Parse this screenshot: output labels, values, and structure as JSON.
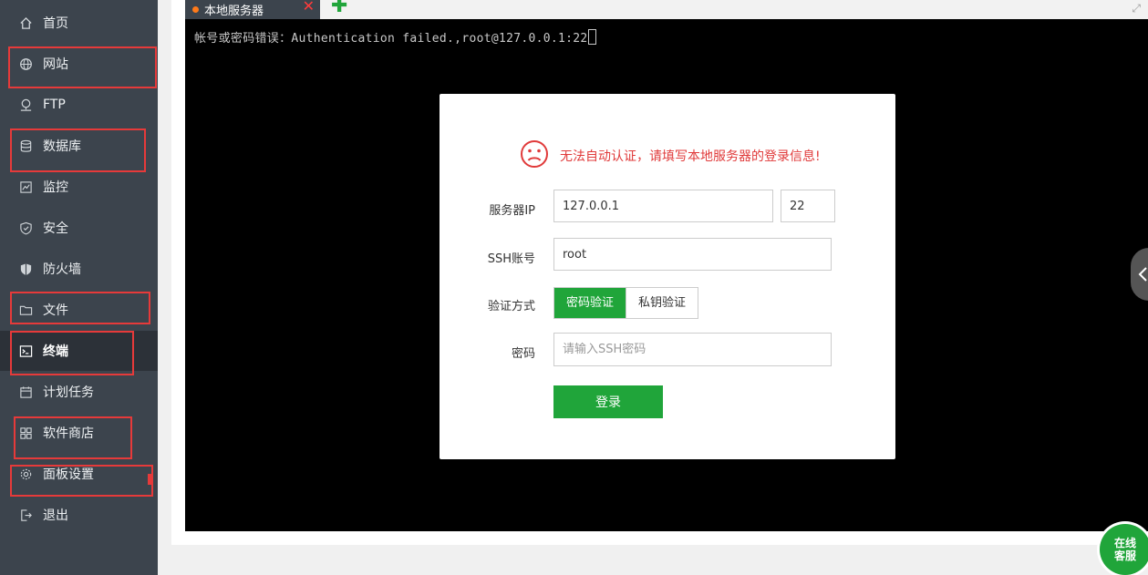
{
  "sidebar": {
    "items": [
      {
        "label": "首页",
        "icon": "home-icon"
      },
      {
        "label": "网站",
        "icon": "globe-icon"
      },
      {
        "label": "FTP",
        "icon": "ftp-icon"
      },
      {
        "label": "数据库",
        "icon": "database-icon"
      },
      {
        "label": "监控",
        "icon": "monitor-icon"
      },
      {
        "label": "安全",
        "icon": "shield-icon"
      },
      {
        "label": "防火墙",
        "icon": "firewall-icon"
      },
      {
        "label": "文件",
        "icon": "folder-icon"
      },
      {
        "label": "终端",
        "icon": "terminal-icon",
        "active": true
      },
      {
        "label": "计划任务",
        "icon": "calendar-icon"
      },
      {
        "label": "软件商店",
        "icon": "grid-icon"
      },
      {
        "label": "面板设置",
        "icon": "gear-icon"
      },
      {
        "label": "退出",
        "icon": "logout-icon"
      }
    ]
  },
  "tabs": {
    "active_label": "本地服务器",
    "close_glyph": "✕",
    "add_glyph": "✚",
    "expand_glyph": "⤢"
  },
  "terminal": {
    "output": "帐号或密码错误：Authentication failed.,root@127.0.0.1:22"
  },
  "dialog": {
    "message": "无法自动认证，请填写本地服务器的登录信息!",
    "server_ip_label": "服务器IP",
    "server_ip_value": "127.0.0.1",
    "port_value": "22",
    "ssh_user_label": "SSH账号",
    "ssh_user_value": "root",
    "auth_label": "验证方式",
    "auth_options": [
      "密码验证",
      "私钥验证"
    ],
    "password_label": "密码",
    "password_placeholder": "请输入SSH密码",
    "login_button": "登录"
  },
  "chat": {
    "line1": "在线",
    "line2": "客服"
  },
  "colors": {
    "sidebar_bg": "#3c444d",
    "accent_green": "#20a53a",
    "error_red": "#e03a3a",
    "annotation_red": "#e63a3a"
  }
}
